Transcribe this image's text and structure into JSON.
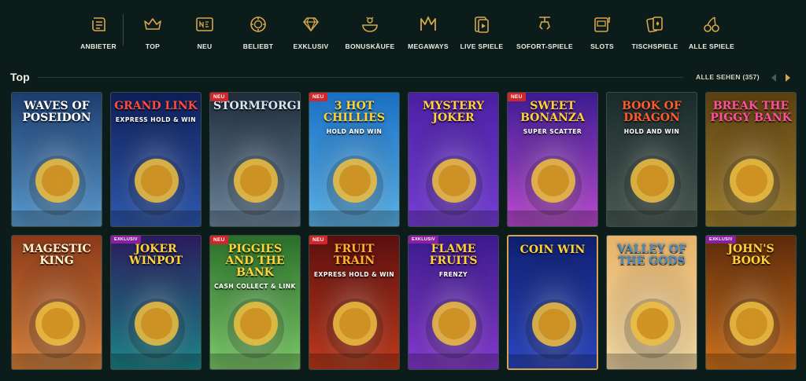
{
  "nav": [
    {
      "label": "ANBIETER",
      "icon": "scroll-icon"
    },
    {
      "label": "TOP",
      "icon": "crown-icon"
    },
    {
      "label": "NEU",
      "icon": "new-badge-icon"
    },
    {
      "label": "BELIEBT",
      "icon": "chip-icon"
    },
    {
      "label": "EXKLUSIV",
      "icon": "diamond-icon"
    },
    {
      "label": "BONUSKÄUFE",
      "icon": "gift-icon"
    },
    {
      "label": "MEGAWAYS",
      "icon": "megaways-icon"
    },
    {
      "label": "LIVE SPIELE",
      "icon": "live-card-icon"
    },
    {
      "label": "SOFORT-SPIELE",
      "icon": "claw-icon"
    },
    {
      "label": "SLOTS",
      "icon": "slot-machine-icon"
    },
    {
      "label": "TISCHSPIELE",
      "icon": "cards-icon"
    },
    {
      "label": "ALLE SPIELE",
      "icon": "cherries-icon"
    }
  ],
  "section": {
    "title": "Top",
    "see_all": "ALLE SEHEN (357)"
  },
  "games": [
    {
      "title": "WAVES OF POSEIDON",
      "sub": "",
      "badge": "",
      "bg1": "#1d3c6e",
      "bg2": "#5aa0d8",
      "text": "#ffffff"
    },
    {
      "title": "GRAND LINK",
      "sub": "EXPRESS HOLD & WIN",
      "badge": "",
      "bg1": "#0e1f57",
      "bg2": "#2f5bb8",
      "text": "#ff4b3a"
    },
    {
      "title": "STORMFORGED",
      "sub": "",
      "badge": "NEU",
      "bg1": "#1f2c3a",
      "bg2": "#6e8aa3",
      "text": "#d9e4ee"
    },
    {
      "title": "3 HOT CHILLIES",
      "sub": "HOLD AND WIN",
      "badge": "NEU",
      "bg1": "#1a6fc2",
      "bg2": "#5db8f0",
      "text": "#ffd233"
    },
    {
      "title": "MYSTERY JOKER",
      "sub": "",
      "badge": "",
      "bg1": "#4a1fa0",
      "bg2": "#7a3fe0",
      "text": "#ffd23a"
    },
    {
      "title": "SWEET BONANZA",
      "sub": "SUPER SCATTER",
      "badge": "NEU",
      "bg1": "#3b1c8f",
      "bg2": "#c24bd8",
      "text": "#ffd23a"
    },
    {
      "title": "BOOK OF DRAGON",
      "sub": "HOLD AND WIN",
      "badge": "",
      "bg1": "#1a2a2a",
      "bg2": "#4c5c55",
      "text": "#ff5a2a"
    },
    {
      "title": "BREAK THE PIGGY BANK",
      "sub": "",
      "badge": "",
      "bg1": "#5a3f10",
      "bg2": "#a7842c",
      "text": "#ff4fa0"
    },
    {
      "title": "MAGESTIC KING",
      "sub": "",
      "badge": "",
      "bg1": "#8a3a1a",
      "bg2": "#e0853a",
      "text": "#fff3cf"
    },
    {
      "title": "JOKER WINPOT",
      "sub": "",
      "badge": "EXKLUSIV",
      "bg1": "#2b1a5c",
      "bg2": "#1b8a8f",
      "text": "#ffd23a"
    },
    {
      "title": "PIGGIES AND THE BANK",
      "sub": "CASH COLLECT & LINK",
      "badge": "NEU",
      "bg1": "#2a6e2a",
      "bg2": "#7fd06a",
      "text": "#ffd23a"
    },
    {
      "title": "FRUIT TRAIN",
      "sub": "EXPRESS HOLD & WIN",
      "badge": "NEU",
      "bg1": "#5a0f0f",
      "bg2": "#c73a1a",
      "text": "#ffb32a"
    },
    {
      "title": "FLAME FRUITS",
      "sub": "FRENZY",
      "badge": "EXKLUSIV",
      "bg1": "#3a1a8a",
      "bg2": "#8a3ad8",
      "text": "#ffd23a"
    },
    {
      "title": "COIN WIN",
      "sub": "",
      "badge": "",
      "bg1": "#0f1f6e",
      "bg2": "#2a47c8",
      "text": "#ffd23a"
    },
    {
      "title": "VALLEY OF THE GODS",
      "sub": "",
      "badge": "",
      "bg1": "#e6b36a",
      "bg2": "#f6dca6",
      "text": "#4a8ac2"
    },
    {
      "title": "JOHN'S BOOK",
      "sub": "",
      "badge": "EXKLUSIV",
      "bg1": "#5a2a0a",
      "bg2": "#d8751a",
      "text": "#ffd23a"
    }
  ],
  "colors": {
    "background": "#0c1c1a",
    "accent_gold": "#d6a64a",
    "badge_red": "#d2262a"
  }
}
